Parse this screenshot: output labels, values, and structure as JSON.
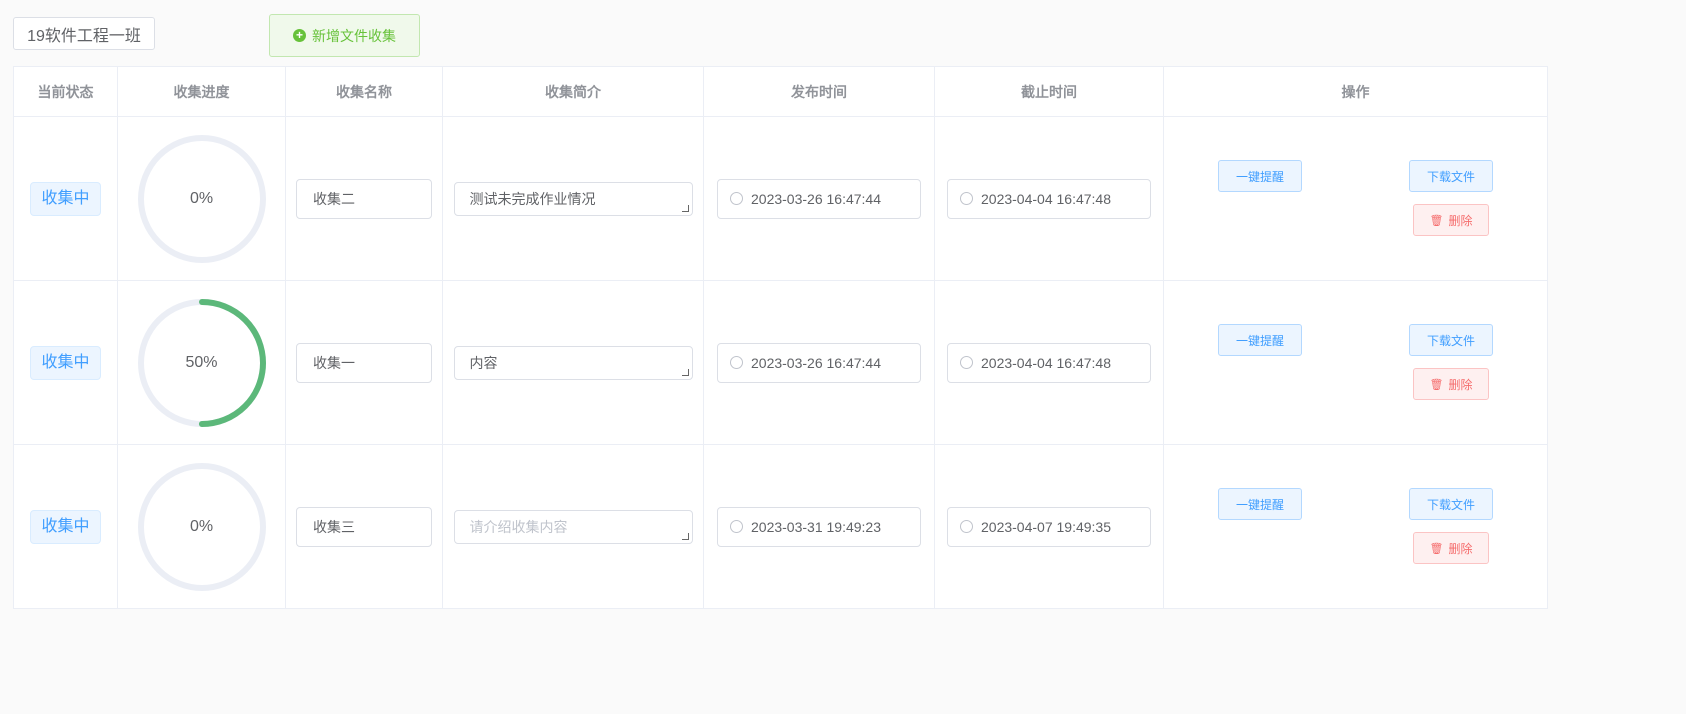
{
  "class_name": "19软件工程一班",
  "add_button": "新增文件收集",
  "headers": [
    "当前状态",
    "收集进度",
    "收集名称",
    "收集简介",
    "发布时间",
    "截止时间",
    "操作"
  ],
  "rows": [
    {
      "status": "收集中",
      "progress": 0,
      "progress_label": "0%",
      "name": "收集二",
      "intro": "测试未完成作业情况",
      "intro_placeholder": "",
      "publish": "2023-03-26 16:47:44",
      "deadline": "2023-04-04 16:47:48"
    },
    {
      "status": "收集中",
      "progress": 50,
      "progress_label": "50%",
      "name": "收集一",
      "intro": "内容",
      "intro_placeholder": "",
      "publish": "2023-03-26 16:47:44",
      "deadline": "2023-04-04 16:47:48"
    },
    {
      "status": "收集中",
      "progress": 0,
      "progress_label": "0%",
      "name": "收集三",
      "intro": "",
      "intro_placeholder": "请介绍收集内容",
      "publish": "2023-03-31 19:49:23",
      "deadline": "2023-04-07 19:49:35"
    }
  ],
  "actions": {
    "remind": "一键提醒",
    "download": "下载文件",
    "delete": "删除"
  },
  "colors": {
    "progress": "#5cb87a",
    "track": "#ebeef5",
    "primary": "#409eff",
    "danger": "#f56c6c",
    "success": "#67c23a"
  }
}
